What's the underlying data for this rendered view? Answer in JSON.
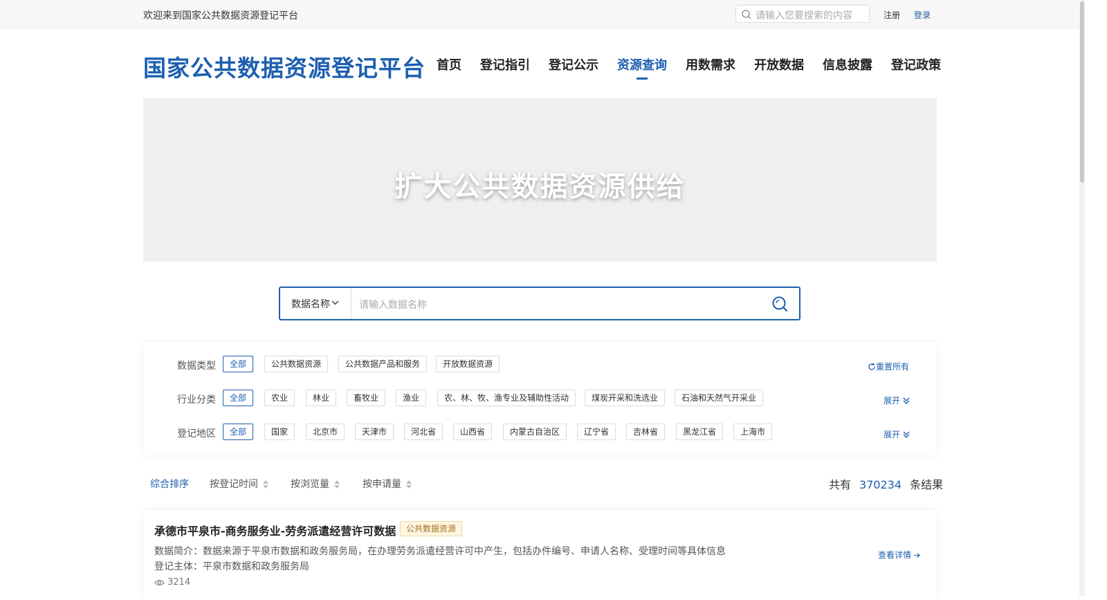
{
  "topbar": {
    "welcome": "欢迎来到国家公共数据资源登记平台",
    "search_placeholder": "请输入您要搜索的内容",
    "register": "注册",
    "login": "登录"
  },
  "header": {
    "logo": "国家公共数据资源登记平台",
    "nav": [
      "首页",
      "登记指引",
      "登记公示",
      "资源查询",
      "用数需求",
      "开放数据",
      "信息披露",
      "登记政策"
    ],
    "active_nav": "资源查询"
  },
  "banner": {
    "text": "扩大公共数据资源供给"
  },
  "search": {
    "type": "数据名称",
    "placeholder": "请输入数据名称"
  },
  "filters": {
    "reset_all": "重置所有",
    "expand": "展开",
    "rows": [
      {
        "label": "数据类型",
        "tags": [
          "全部",
          "公共数据资源",
          "公共数据产品和服务",
          "开放数据资源"
        ]
      },
      {
        "label": "行业分类",
        "tags": [
          "全部",
          "农业",
          "林业",
          "畜牧业",
          "渔业",
          "农、林、牧、渔专业及辅助性活动",
          "煤炭开采和洗选业",
          "石油和天然气开采业"
        ]
      },
      {
        "label": "登记地区",
        "tags": [
          "全部",
          "国家",
          "北京市",
          "天津市",
          "河北省",
          "山西省",
          "内蒙古自治区",
          "辽宁省",
          "吉林省",
          "黑龙江省",
          "上海市"
        ]
      }
    ]
  },
  "sort": {
    "options": [
      "综合排序",
      "按登记时间",
      "按浏览量",
      "按申请量"
    ],
    "active": "综合排序"
  },
  "results": {
    "prefix": "共有",
    "count": "370234",
    "suffix": "条结果",
    "items": [
      {
        "title": "承德市平泉市-商务服务业-劳务派遣经营许可数据",
        "badge": "公共数据资源",
        "desc": "数据简介：数据来源于平泉市数据和政务服务局，在办理劳务派遣经营许可中产生，包括办件编号、申请人名称、受理时间等具体信息",
        "owner": "登记主体：平泉市数据和政务服务局",
        "views": "3214",
        "detail": "查看详情"
      }
    ]
  },
  "colors": {
    "primary": "#1d5fb0",
    "badge_bg": "#fdf6e4",
    "badge_text": "#a5731b"
  }
}
